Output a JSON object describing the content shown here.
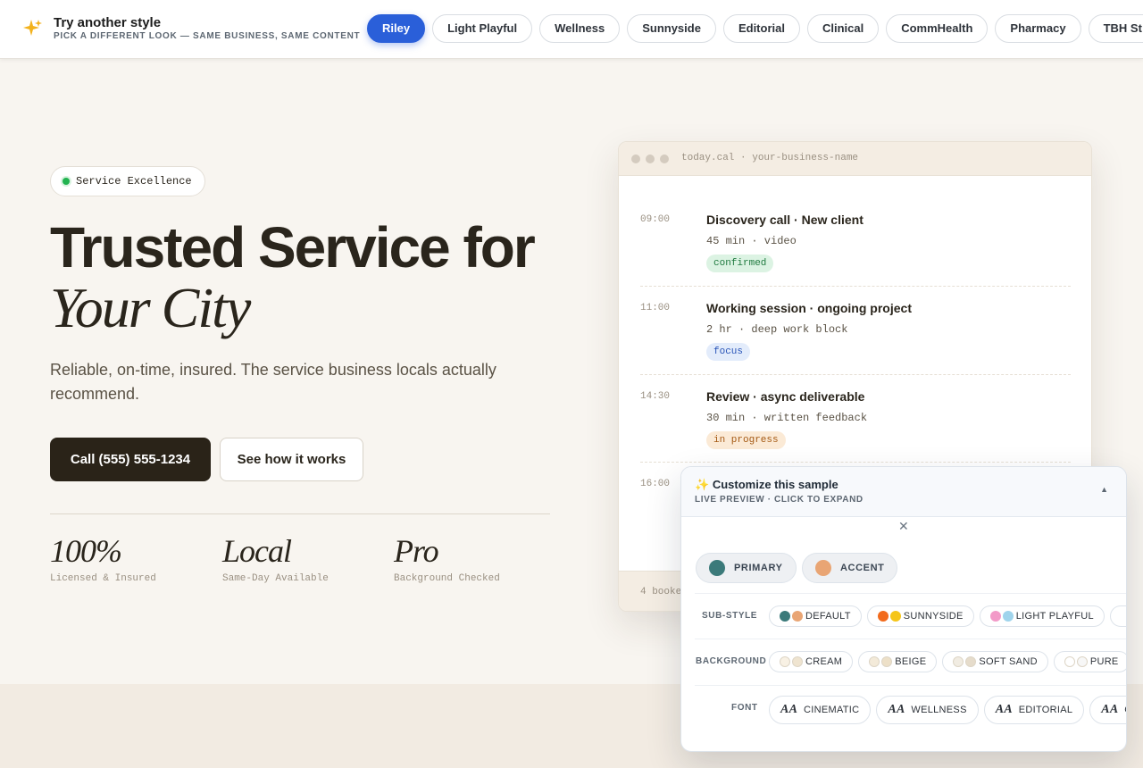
{
  "topbar": {
    "title": "Try another style",
    "subtitle": "PICK A DIFFERENT LOOK — SAME BUSINESS, SAME CONTENT",
    "styles": [
      "Riley",
      "Light Playful",
      "Wellness",
      "Sunnyside",
      "Editorial",
      "Clinical",
      "CommHealth",
      "Pharmacy",
      "TBH St"
    ],
    "active_style": "Riley",
    "spark_icon": "sparkle-icon"
  },
  "hero": {
    "badge": "Service Excellence",
    "headline_line1": "Trusted Service for",
    "headline_line2": "Your City",
    "lede": "Reliable, on-time, insured. The service business locals actually recommend.",
    "cta_primary": "Call (555) 555-1234",
    "cta_secondary": "See how it works",
    "stats": [
      {
        "value": "100%",
        "label": "Licensed & Insured"
      },
      {
        "value": "Local",
        "label": "Same-Day Available"
      },
      {
        "value": "Pro",
        "label": "Background Checked"
      }
    ]
  },
  "calendar": {
    "title": "today.cal · your-business-name",
    "events": [
      {
        "time": "09:00",
        "title": "Discovery call · New client",
        "meta": "45 min · video",
        "tag": "confirmed",
        "tag_bg": "#dcf3e3",
        "tag_fg": "#1f7a3f"
      },
      {
        "time": "11:00",
        "title": "Working session · ongoing project",
        "meta": "2 hr · deep work block",
        "tag": "focus",
        "tag_bg": "#e3ecfb",
        "tag_fg": "#2a55b8"
      },
      {
        "time": "14:30",
        "title": "Review · async deliverable",
        "meta": "30 min · written feedback",
        "tag": "in progress",
        "tag_bg": "#fbead6",
        "tag_fg": "#a55a14"
      },
      {
        "time": "16:00"
      }
    ],
    "footer": "4 booke"
  },
  "customize": {
    "title": "Customize this sample",
    "subtitle": "LIVE PREVIEW · CLICK TO EXPAND",
    "title_icon": "sparkle-icon",
    "close_glyph": "✕",
    "collapse_glyph": "▲",
    "primary_label": "PRIMARY",
    "primary_color": "#3b7a7a",
    "accent_label": "ACCENT",
    "accent_color": "#e9a574",
    "substyle_label": "SUB-STYLE",
    "substyles": [
      {
        "name": "DEFAULT",
        "c1": "#3b7a7a",
        "c2": "#e9a574"
      },
      {
        "name": "SUNNYSIDE",
        "c1": "#f26b1d",
        "c2": "#f5c518"
      },
      {
        "name": "LIGHT PLAYFUL",
        "c1": "#f29ac8",
        "c2": "#9fd4ec"
      }
    ],
    "background_label": "BACKGROUND",
    "backgrounds": [
      {
        "name": "CREAM",
        "c1": "#f8f1e4",
        "c2": "#efe4d0"
      },
      {
        "name": "BEIGE",
        "c1": "#f3ead9",
        "c2": "#ede0c8"
      },
      {
        "name": "SOFT SAND",
        "c1": "#f1ece2",
        "c2": "#e6dccb"
      },
      {
        "name": "PURE",
        "c1": "#ffffff",
        "c2": "#f7f7f7"
      }
    ],
    "font_label": "FONT",
    "fonts": [
      "CINEMATIC",
      "WELLNESS",
      "EDITORIAL",
      "C"
    ],
    "font_glyph": "AA"
  }
}
